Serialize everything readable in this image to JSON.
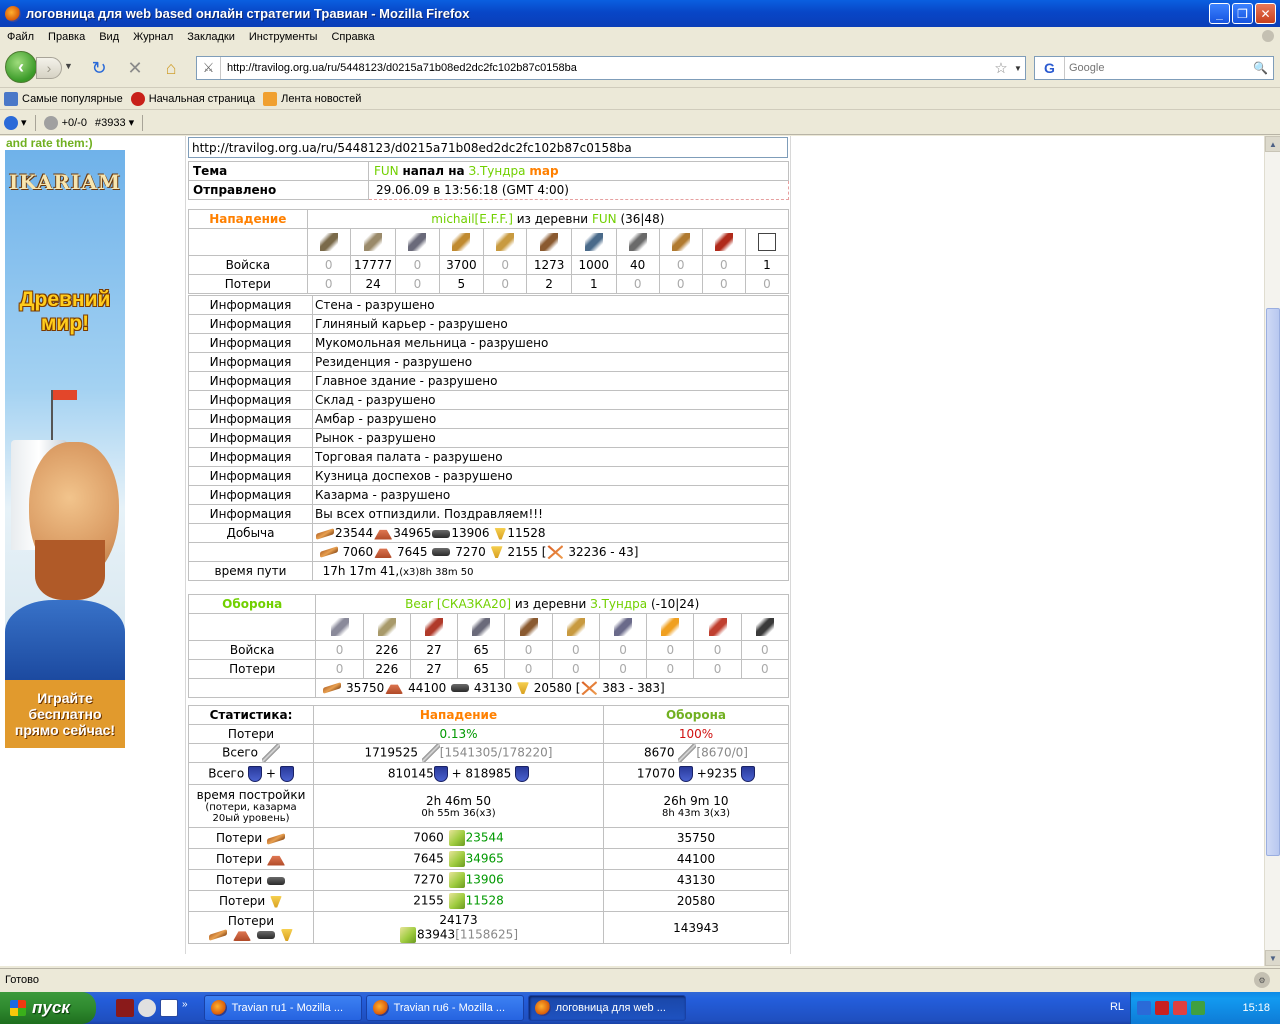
{
  "window": {
    "title": "логовница для web based онлайн стратегии Травиан - Mozilla Firefox"
  },
  "menu": [
    "Файл",
    "Правка",
    "Вид",
    "Журнал",
    "Закладки",
    "Инструменты",
    "Справка"
  ],
  "nav": {
    "url": "http://travilog.org.ua/ru/5448123/d0215a71b08ed2dc2fc102b87c0158ba",
    "search_placeholder": "Google",
    "search_engine_letter": "G"
  },
  "bookmarks": [
    {
      "label": "Самые популярные",
      "color": "#4a78c8"
    },
    {
      "label": "Начальная страница",
      "color": "#c8201a"
    },
    {
      "label": "Лента новостей",
      "color": "#f0a030"
    }
  ],
  "addon": {
    "rating": "+0/-0",
    "rank": "#3933"
  },
  "page": {
    "rate_text": "and rate them:)",
    "banner": {
      "logo": "IKARIAM",
      "slogan": "Древний мир!",
      "cta": "Играйте бесплатно прямо сейчас!"
    },
    "link": "http://travilog.org.ua/ru/5448123/d0215a71b08ed2dc2fc102b87c0158ba",
    "header": {
      "subject_label": "Тема",
      "subject_attacker": "FUN",
      "subject_mid": "напал на",
      "subject_target": "З.Тундра",
      "subject_map": "map",
      "sent_label": "Отправлено",
      "sent_value": "29.06.09 в 13:56:18 (GMT 4:00)"
    },
    "attack": {
      "side_label": "Нападение",
      "player": "michail",
      "alliance": "[E.F.F.]",
      "from_village_text": "из деревни",
      "village": "FUN",
      "coords": "(36|48)",
      "troops_label": "Войска",
      "losses_label": "Потери",
      "troops": [
        "0",
        "17777",
        "0",
        "3700",
        "0",
        "1273",
        "1000",
        "40",
        "0",
        "0",
        "1"
      ],
      "losses": [
        "0",
        "24",
        "0",
        "5",
        "0",
        "2",
        "1",
        "0",
        "0",
        "0",
        "0"
      ],
      "info_label": "Информация",
      "info": [
        "Стена - разрушено",
        "Глиняный карьер - разрушено",
        "Мукомольная мельница - разрушено",
        "Резиденция - разрушено",
        "Главное здание - разрушено",
        "Склад - разрушено",
        "Амбар - разрушено",
        "Рынок - разрушено",
        "Торговая палата - разрушено",
        "Кузница доспехов - разрушено",
        "Казарма - разрушено",
        "Вы всех отпиздили. Поздравляем!!!"
      ],
      "bounty_label": "Добыча",
      "bounty": [
        "23544",
        "34965",
        "13906",
        "11528"
      ],
      "bounty2": [
        "7060",
        "7645",
        "7270",
        "2155"
      ],
      "bounty2_total": "32236 - 43",
      "travel_label": "время пути",
      "travel": "17h 17m 41,",
      "travel_x3": "(x3)8h 38m 50"
    },
    "defense": {
      "side_label": "Оборона",
      "player": "Bear",
      "alliance": "[СКАЗКА20]",
      "from_village_text": "из деревни",
      "village": "З.Тундра",
      "coords": "(-10|24)",
      "troops_label": "Войска",
      "losses_label": "Потери",
      "troops": [
        "0",
        "226",
        "27",
        "65",
        "0",
        "0",
        "0",
        "0",
        "0",
        "0"
      ],
      "losses": [
        "0",
        "226",
        "27",
        "65",
        "0",
        "0",
        "0",
        "0",
        "0",
        "0"
      ],
      "res": [
        "35750",
        "44100",
        "43130",
        "20580"
      ],
      "res_total": "383 - 383"
    },
    "stats": {
      "title": "Статистика:",
      "col_attack": "Нападение",
      "col_defense": "Оборона",
      "losses_label": "Потери",
      "losses_attack": "0.13%",
      "losses_defense": "100%",
      "total_label": "Всего",
      "plus": "+",
      "total_atk_attack": "1719525",
      "total_atk_attack_detail": "[1541305/178220]",
      "total_atk_defense": "8670",
      "total_atk_defense_detail": "[8670/0]",
      "total_def_attack_a": "810145",
      "total_def_attack_b": "+ 818985",
      "total_def_defense_a": "17070",
      "total_def_defense_b": "+9235",
      "build_label": "время постройки",
      "build_sub": "(потери, казарма 20ый уровень)",
      "build_attack": "2h 46m 50",
      "build_attack_x3": "0h 55m 36(x3)",
      "build_defense": "26h 9m 10",
      "build_defense_x3": "8h 43m 3(x3)",
      "res_rows": [
        {
          "a": "7060",
          "b": "23544",
          "d": "35750",
          "res": "wood"
        },
        {
          "a": "7645",
          "b": "34965",
          "d": "44100",
          "res": "clay"
        },
        {
          "a": "7270",
          "b": "13906",
          "d": "43130",
          "res": "iron"
        },
        {
          "a": "2155",
          "b": "11528",
          "d": "20580",
          "res": "crop"
        }
      ],
      "sum_a": "24173",
      "sum_b": "83943",
      "sum_b_detail": "[1158625]",
      "sum_d": "143943"
    }
  },
  "status": "Готово",
  "taskbar": {
    "start": "пуск",
    "tasks": [
      {
        "label": "Travian ru1 - Mozilla ...",
        "active": false
      },
      {
        "label": "Travian ru6 - Mozilla ...",
        "active": false
      },
      {
        "label": "логовница для web ...",
        "active": true
      }
    ],
    "lang": "RL",
    "clock": "15:18"
  }
}
